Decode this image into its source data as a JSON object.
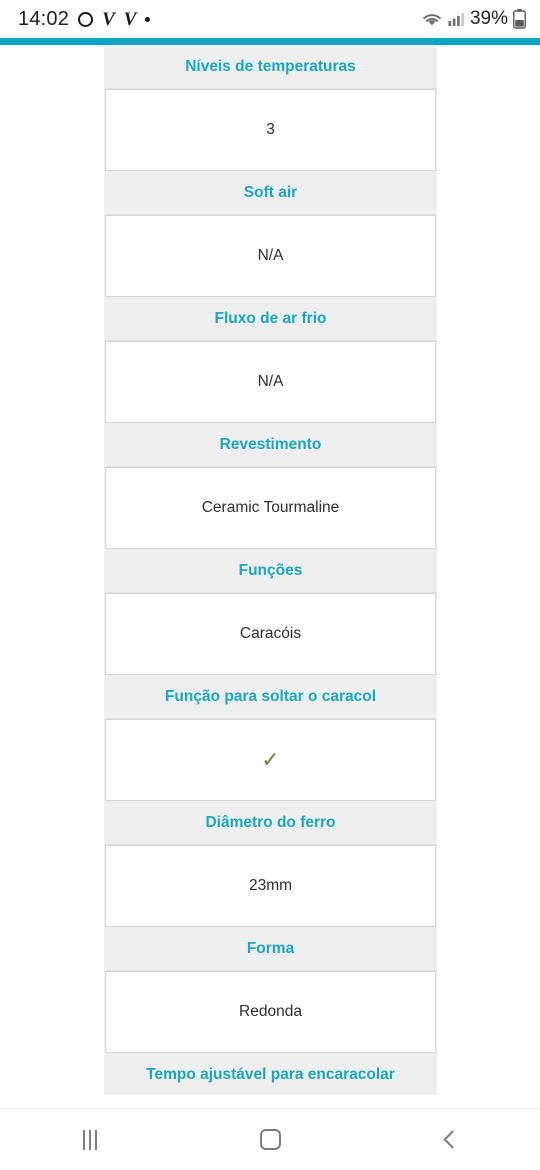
{
  "status_bar": {
    "clock": "14:02",
    "icons": [
      "circle-outline-icon",
      "v-app-icon",
      "v-app-icon",
      "dot-icon"
    ],
    "wifi_icon": "wifi-icon",
    "signal_icon": "cellular-signal-icon",
    "battery_percent": "39%",
    "battery_icon": "battery-icon"
  },
  "specs": [
    {
      "label": "Níveis de temperaturas",
      "value": "3"
    },
    {
      "label": "Soft air",
      "value": "N/A"
    },
    {
      "label": "Fluxo de ar frio",
      "value": "N/A"
    },
    {
      "label": "Revestimento",
      "value": "Ceramic Tourmaline"
    },
    {
      "label": "Funções",
      "value": "Caracóis"
    },
    {
      "label": "Função para soltar o caracol",
      "value": "✓",
      "is_check": true
    },
    {
      "label": "Diâmetro do ferro",
      "value": "23mm"
    },
    {
      "label": "Forma",
      "value": "Redonda"
    },
    {
      "label": "Tempo ajustável para encaracolar",
      "value": ""
    }
  ],
  "nav_bar": {
    "recents_label": "recents-button",
    "home_label": "home-button",
    "back_label": "back-button"
  },
  "colors": {
    "accent_teal": "#18a8c4",
    "header_bar": "#0fa5c2",
    "panel_bg": "#efefef",
    "check_olive": "#7e7e42"
  }
}
